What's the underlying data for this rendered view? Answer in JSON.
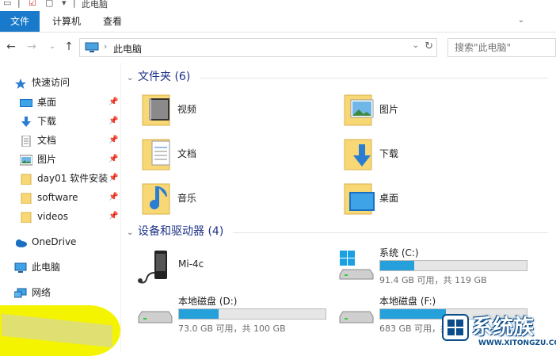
{
  "window": {
    "title": "此电脑"
  },
  "ribbon": {
    "tabs": [
      "文件",
      "计算机",
      "查看"
    ]
  },
  "address": {
    "crumb": "此电脑"
  },
  "search": {
    "placeholder": "搜索\"此电脑\""
  },
  "nav": {
    "quick_access": "快速访问",
    "items": [
      "桌面",
      "下载",
      "文档",
      "图片",
      "day01 软件安装",
      "software",
      "videos"
    ],
    "onedrive": "OneDrive",
    "this_pc": "此电脑",
    "network": "网络"
  },
  "folders_group": {
    "title": "文件夹 (6)"
  },
  "folders": [
    "视频",
    "图片",
    "文档",
    "下载",
    "音乐",
    "桌面"
  ],
  "devices_group": {
    "title": "设备和驱动器 (4)"
  },
  "devices": [
    {
      "name": "Mi-4c"
    },
    {
      "name": "系统 (C:)",
      "info": "91.4 GB 可用，共 119 GB",
      "used_fraction": 0.23
    },
    {
      "name": "本地磁盘 (D:)",
      "info": "73.0 GB 可用，共 100 GB",
      "used_fraction": 0.27
    },
    {
      "name": "本地磁盘 (F:)",
      "info": "683 GB 可用，共 ...",
      "used_fraction": 0.45
    }
  ],
  "watermark": {
    "text": "系统族",
    "url": "WWW.XITONGZU.COM"
  },
  "colors": {
    "accent": "#1979ca",
    "highlight": "#f4f400",
    "bar": "#26a0da"
  }
}
